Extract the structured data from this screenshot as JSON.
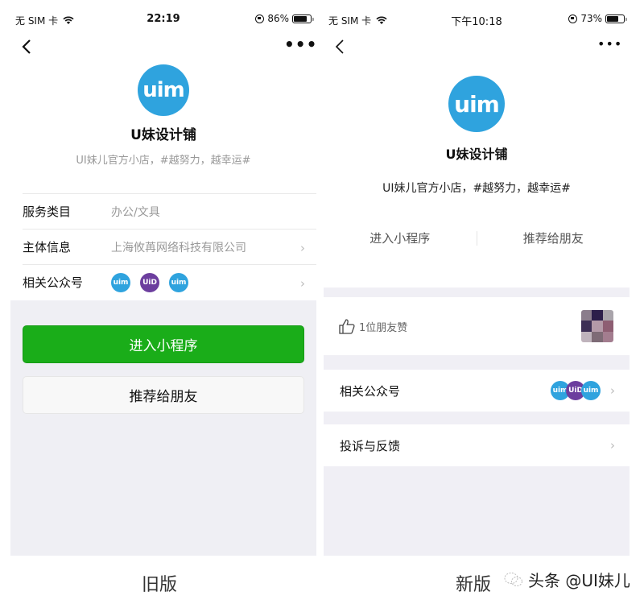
{
  "old_version": {
    "status_bar": {
      "carrier": "无 SIM 卡",
      "time": "22:19",
      "battery": "86%",
      "battery_level": 0.86
    },
    "nav": {
      "back_icon": "chevron-left-icon",
      "more_icon": "ellipsis-icon",
      "more_label": "•••"
    },
    "profile": {
      "logo_text": "uim",
      "name": "U妹设计铺",
      "description": "UI妹儿官方小店，#越努力，越幸运#"
    },
    "info_rows": [
      {
        "label": "服务类目",
        "value": "办公/文具"
      },
      {
        "label": "主体信息",
        "value": "上海攸苒网络科技有限公司"
      },
      {
        "label": "相关公众号",
        "accounts": [
          "uim",
          "UiD",
          "uim"
        ]
      }
    ],
    "buttons": {
      "enter": "进入小程序",
      "recommend": "推荐给朋友"
    },
    "caption": "旧版"
  },
  "new_version": {
    "status_bar": {
      "carrier": "无 SIM 卡",
      "time": "下午10:18",
      "battery": "73%",
      "battery_level": 0.73
    },
    "nav": {
      "back_icon": "chevron-left-icon",
      "more_icon": "ellipsis-icon",
      "more_label": "•••"
    },
    "profile": {
      "logo_text": "uim",
      "name": "U妹设计铺",
      "description": "UI妹儿官方小店，#越努力，越幸运#"
    },
    "actions": {
      "enter": "进入小程序",
      "recommend": "推荐给朋友"
    },
    "likes": {
      "icon": "thumbs-up-icon",
      "text": "1位朋友赞"
    },
    "related": {
      "label": "相关公众号",
      "accounts": [
        "uim",
        "UiD",
        "uim"
      ]
    },
    "feedback": {
      "label": "投诉与反馈"
    },
    "caption": "新版"
  },
  "watermark": "头条 @UI妹儿",
  "colors": {
    "logo_blue": "#2fa3de",
    "logo_purple": "#6c3e9e",
    "wechat_green": "#1aad19",
    "bg_gray": "#efeff4"
  },
  "chevron": "›"
}
